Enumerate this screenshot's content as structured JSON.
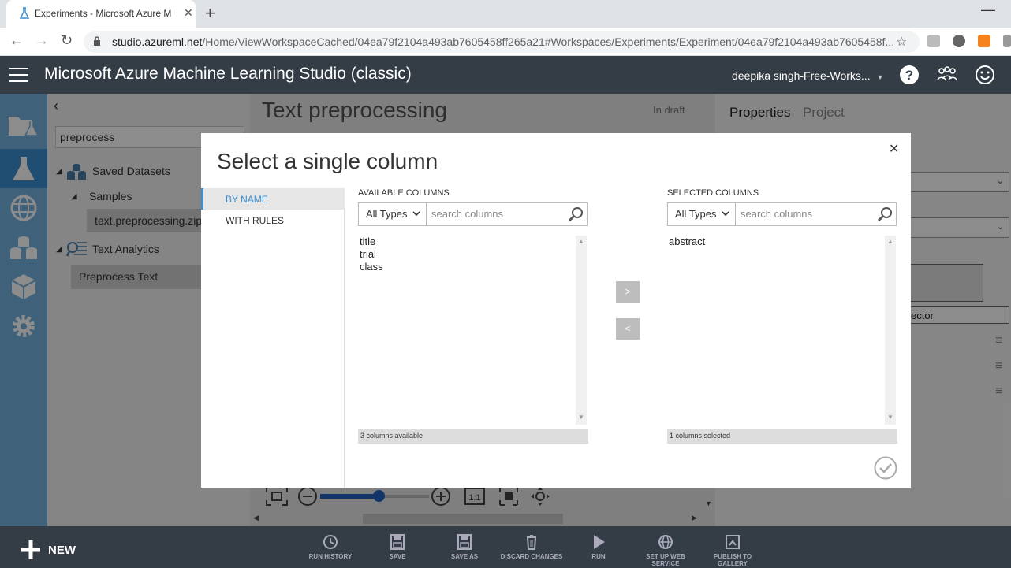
{
  "browser": {
    "tab_title": "Experiments - Microsoft Azure M",
    "url_host": "studio.azureml.net",
    "url_path": "/Home/ViewWorkspaceCached/04ea79f2104a493ab7605458ff265a21#Workspaces/Experiments/Experiment/04ea79f2104a493ab7605458f..."
  },
  "app": {
    "title": "Microsoft Azure Machine Learning Studio (classic)",
    "user": "deepika singh-Free-Works..."
  },
  "palette": {
    "search_value": "preprocess",
    "tree": {
      "saved_datasets": "Saved Datasets",
      "samples": "Samples",
      "dataset_item": "text.preprocessing.zip",
      "text_analytics": "Text Analytics",
      "module_item": "Preprocess Text"
    }
  },
  "experiment": {
    "title": "Text preprocessing",
    "status": "In draft"
  },
  "properties_panel": {
    "tab_properties": "Properties",
    "tab_project": "Project",
    "partial_button_text": "ector"
  },
  "dialog": {
    "title": "Select a single column",
    "nav": [
      "BY NAME",
      "WITH RULES"
    ],
    "available": {
      "header": "AVAILABLE COLUMNS",
      "type_filter": "All Types",
      "search_placeholder": "search columns",
      "items": [
        "title",
        "trial",
        "class"
      ],
      "footer": "3 columns available"
    },
    "selected": {
      "header": "SELECTED COLUMNS",
      "type_filter": "All Types",
      "search_placeholder": "search columns",
      "items": [
        "abstract"
      ],
      "footer": "1 columns selected"
    },
    "move_right": ">",
    "move_left": "<"
  },
  "bottom_toolbar": {
    "new_label": "NEW",
    "buttons": [
      {
        "label_line1": "RUN HISTORY",
        "label_line2": "",
        "icon": "clock-icon"
      },
      {
        "label_line1": "SAVE",
        "label_line2": "",
        "icon": "floppy-icon"
      },
      {
        "label_line1": "SAVE AS",
        "label_line2": "",
        "icon": "floppy-icon"
      },
      {
        "label_line1": "DISCARD CHANGES",
        "label_line2": "",
        "icon": "trash-icon"
      },
      {
        "label_line1": "RUN",
        "label_line2": "",
        "icon": "play-icon"
      },
      {
        "label_line1": "SET UP WEB",
        "label_line2": "SERVICE",
        "icon": "globe-icon"
      },
      {
        "label_line1": "PUBLISH TO",
        "label_line2": "GALLERY",
        "icon": "publish-icon"
      }
    ]
  },
  "colors": {
    "app_header": "#343d46",
    "rail": "#74b3de",
    "rail_active": "#3b8fd1",
    "accent": "#3b8fd1"
  }
}
